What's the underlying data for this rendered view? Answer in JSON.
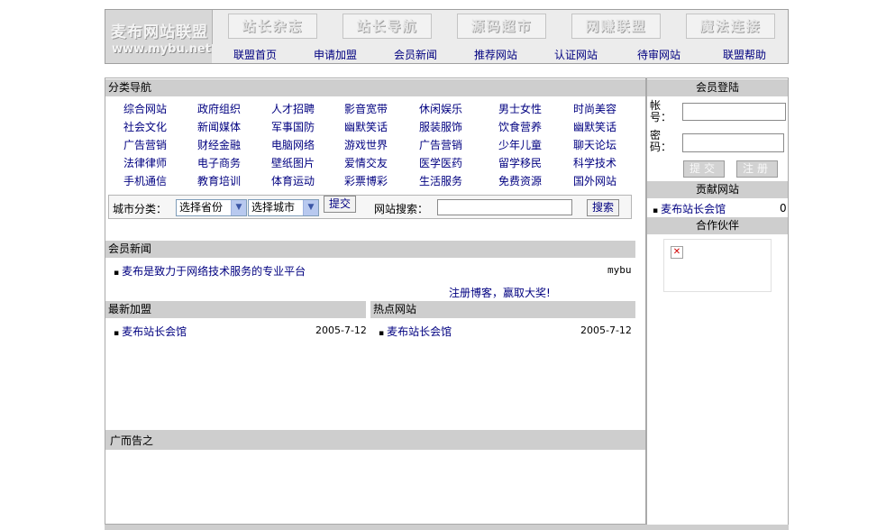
{
  "logo": {
    "cn": "麦布网站联盟",
    "en": "www.mybu.net"
  },
  "banners": [
    "站长杂志",
    "站长导航",
    "源码超市",
    "网赚联盟",
    "魔法连接"
  ],
  "nav": [
    "联盟首页",
    "申请加盟",
    "会员新闻",
    "推荐网站",
    "认证网站",
    "待审网站",
    "联盟帮助"
  ],
  "category": {
    "title": "分类导航",
    "rows": [
      [
        "综合网站",
        "政府组织",
        "人才招聘",
        "影音宽带",
        "休闲娱乐",
        "男士女性",
        "时尚美容"
      ],
      [
        "社会文化",
        "新闻媒体",
        "军事国防",
        "幽默笑话",
        "服装服饰",
        "饮食营养",
        "幽默笑话"
      ],
      [
        "广告营销",
        "财经金融",
        "电脑网络",
        "游戏世界",
        "广告营销",
        "少年儿童",
        "聊天论坛"
      ],
      [
        "法律律师",
        "电子商务",
        "壁纸图片",
        "爱情交友",
        "医学医药",
        "留学移民",
        "科学技术"
      ],
      [
        "手机通信",
        "教育培训",
        "体育运动",
        "彩票博彩",
        "生活服务",
        "免费资源",
        "国外网站"
      ]
    ]
  },
  "city": {
    "label": "城市分类：",
    "province": "选择省份",
    "city": "选择城市",
    "submit": "提交",
    "search_label": "网站搜索：",
    "search_value": "",
    "search_button": "搜索"
  },
  "news": {
    "title": "会员新闻",
    "item": "麦布是致力于网络技术服务的专业平台",
    "item_author": "mybu",
    "promo": "注册博客，赢取大奖!"
  },
  "latest": {
    "title": "最新加盟",
    "items": [
      {
        "name": "麦布站长会馆",
        "date": "2005-7-12"
      }
    ]
  },
  "hot": {
    "title": "热点网站",
    "items": [
      {
        "name": "麦布站长会馆",
        "date": "2005-7-12"
      }
    ]
  },
  "ads": {
    "title": "广而告之"
  },
  "login": {
    "title": "会员登陆",
    "account_label": "帐\n号：",
    "password_label": "密\n码：",
    "account_value": "",
    "password_value": "",
    "submit": "提交",
    "register": "注册"
  },
  "contrib": {
    "title": "贡献网站",
    "items": [
      {
        "name": "麦布站长会馆",
        "count": "0"
      }
    ]
  },
  "partners": {
    "title": "合作伙伴"
  },
  "colors": {
    "bar": "#cecece",
    "link": "#000080",
    "border": "#a9a9a9"
  }
}
